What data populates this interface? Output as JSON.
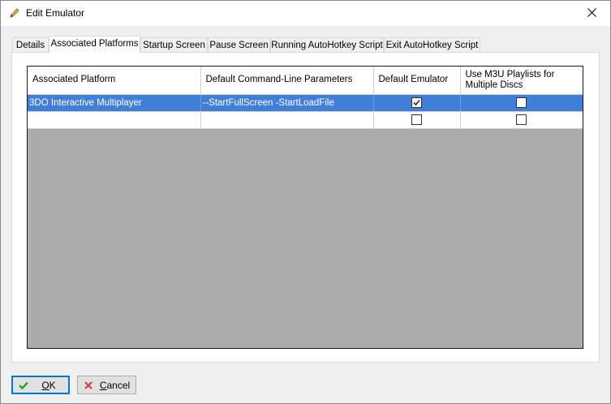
{
  "window": {
    "title": "Edit Emulator",
    "title_icon": "pencil-icon",
    "close_icon": "close-icon"
  },
  "tabs": [
    {
      "label": "Details"
    },
    {
      "label": "Associated Platforms",
      "active": true
    },
    {
      "label": "Startup Screen"
    },
    {
      "label": "Pause Screen"
    },
    {
      "label": "Running AutoHotkey Script"
    },
    {
      "label": "Exit AutoHotkey Script"
    }
  ],
  "grid": {
    "columns": [
      "Associated Platform",
      "Default Command-Line Parameters",
      "Default Emulator",
      "Use M3U Playlists for Multiple Discs"
    ],
    "rows": [
      {
        "platform": "3DO Interactive Multiplayer",
        "params": "--StartFullScreen -StartLoadFile",
        "default_emulator": true,
        "use_m3u": false,
        "selected": true
      },
      {
        "platform": "",
        "params": "",
        "default_emulator": false,
        "use_m3u": false,
        "selected": false
      }
    ]
  },
  "buttons": {
    "ok": {
      "label_prefix": "",
      "label_underlined": "O",
      "label_rest": "K",
      "icon": "checkmark-icon",
      "icon_color": "#2e9e2e"
    },
    "cancel": {
      "label_prefix": "",
      "label_underlined": "C",
      "label_rest": "ancel",
      "icon": "x-icon",
      "icon_color": "#d23a3a"
    }
  },
  "colors": {
    "selection": "#3f7fd8",
    "grid_background": "#ababab",
    "default_button_border": "#0078d7"
  }
}
